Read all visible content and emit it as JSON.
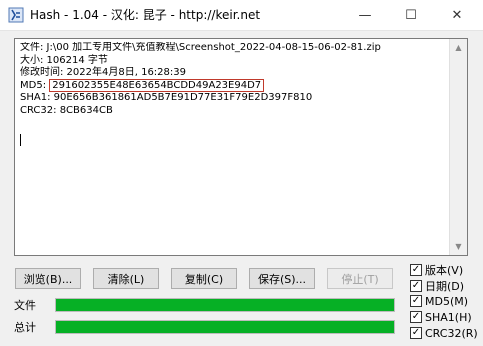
{
  "window": {
    "title": "Hash - 1.04 - 汉化: 昆子 - http://keir.net",
    "minimize_glyph": "—",
    "maximize_glyph": "☐",
    "close_glyph": "✕"
  },
  "output": {
    "lines": [
      "文件: J:\\00 加工专用文件\\充值教程\\Screenshot_2022-04-08-15-06-02-81.zip",
      "大小: 106214 字节",
      "修改时间: 2022年4月8日, 16:28:39"
    ],
    "md5_label": "MD5: ",
    "md5_value": "291602355E48E63654BCDD49A23E94D7",
    "sha1_line": "SHA1: 90E656B361861AD5B7E91D77E31F79E2D397F810",
    "crc32_line": "CRC32: 8CB634CB"
  },
  "buttons": {
    "browse": "浏览(B)...",
    "clear": "清除(L)",
    "copy": "复制(C)",
    "save": "保存(S)...",
    "stop": "停止(T)"
  },
  "progress": {
    "file_label": "文件",
    "total_label": "总计",
    "file_percent": 100,
    "total_percent": 100,
    "bar_color": "#06b025"
  },
  "options": [
    {
      "label": "版本(V)",
      "checked": true
    },
    {
      "label": "日期(D)",
      "checked": true
    },
    {
      "label": "MD5(M)",
      "checked": true
    },
    {
      "label": "SHA1(H)",
      "checked": true
    },
    {
      "label": "CRC32(R)",
      "checked": true
    }
  ],
  "check_glyph": "✓"
}
